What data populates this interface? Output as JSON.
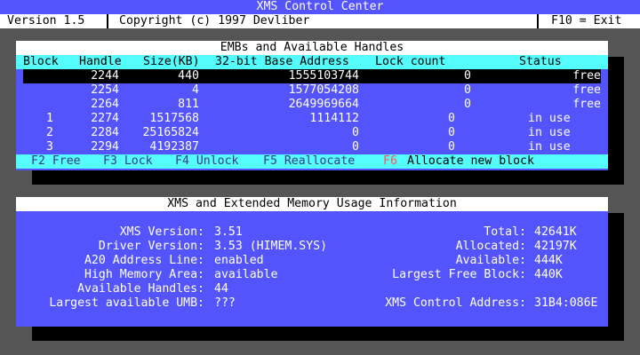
{
  "app": {
    "title": "XMS Control Center"
  },
  "statusbar": {
    "version": "Version 1.5",
    "copyright": "Copyright (c) 1997 Devliber",
    "exit": "F10 = Exit"
  },
  "emb_panel": {
    "title": "EMBs and Available Handles",
    "columns": {
      "block": "Block",
      "handle": "Handle",
      "size": "Size(KB)",
      "base": "32-bit Base Address",
      "lock": "Lock count",
      "status": "Status"
    },
    "rows": [
      {
        "block": "",
        "handle": "2244",
        "size": "440",
        "base": "1555103744",
        "lock": "0",
        "status": "free",
        "selected": true
      },
      {
        "block": "",
        "handle": "2254",
        "size": "4",
        "base": "1577054208",
        "lock": "0",
        "status": "free",
        "selected": false
      },
      {
        "block": "",
        "handle": "2264",
        "size": "811",
        "base": "2649969664",
        "lock": "0",
        "status": "free",
        "selected": false
      },
      {
        "block": "1",
        "handle": "2274",
        "size": "1517568",
        "base": "1114112",
        "lock": "0",
        "status": "in use",
        "selected": false
      },
      {
        "block": "2",
        "handle": "2284",
        "size": "25165824",
        "base": "0",
        "lock": "0",
        "status": "in use",
        "selected": false
      },
      {
        "block": "3",
        "handle": "2294",
        "size": "4192387",
        "base": "0",
        "lock": "0",
        "status": "in use",
        "selected": false
      }
    ],
    "fkeys": {
      "f2": "F2 Free",
      "f3": "F3 Lock",
      "f4": "F4 Unlock",
      "f5": "F5 Reallocate",
      "f6_key": "F6",
      "f6_label": "Allocate new block"
    }
  },
  "xms_panel": {
    "title": "XMS and Extended Memory Usage Information",
    "left": [
      {
        "label": "XMS Version:",
        "value": "3.51"
      },
      {
        "label": "Driver Version:",
        "value": "3.53 (HIMEM.SYS)"
      },
      {
        "label": "A20 Address Line:",
        "value": "enabled"
      },
      {
        "label": "High Memory Area:",
        "value": "available"
      },
      {
        "label": "Available Handles:",
        "value": "44"
      },
      {
        "label": "Largest available UMB:",
        "value": "???"
      }
    ],
    "right": [
      {
        "label": "Total:",
        "value": "42641K"
      },
      {
        "label": "Allocated:",
        "value": "42197K"
      },
      {
        "label": "Available:",
        "value": "444K"
      },
      {
        "label": "Largest Free Block:",
        "value": "440K"
      },
      {
        "label": "",
        "value": ""
      },
      {
        "label": "XMS Control Address:",
        "value": "31B4:086E"
      }
    ]
  },
  "colors": {
    "desktop": "#555555",
    "panel": "#5454fc",
    "header": "#54fcfc",
    "highlight": "#fc5454"
  }
}
